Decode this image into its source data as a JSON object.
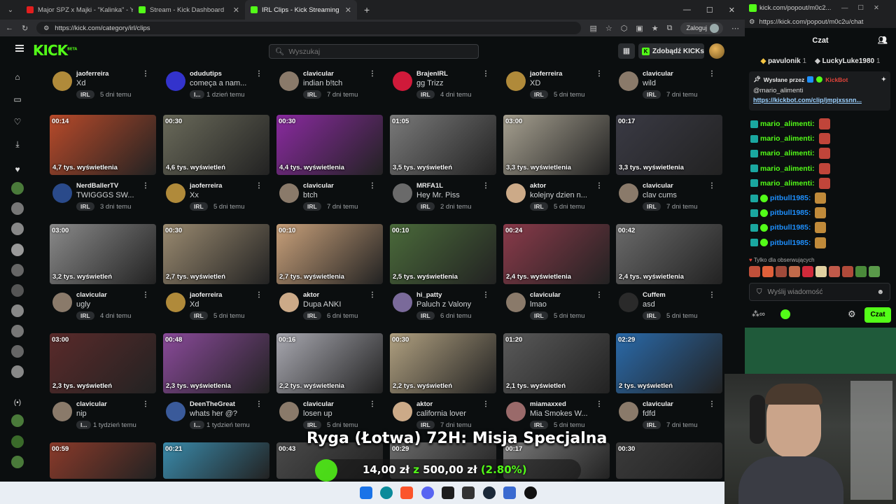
{
  "browser": {
    "tabs": [
      {
        "label": "Major SPZ x Majki - \"Kalinka\" - Yo",
        "color": "#e21e1e"
      },
      {
        "label": "Stream - Kick Dashboard",
        "color": "#53fc18"
      },
      {
        "label": "IRL Clips - Kick Streaming",
        "color": "#53fc18"
      }
    ],
    "url": "https://kick.com/category/irl/clips",
    "login_label": "Zaloguj"
  },
  "kick": {
    "search_placeholder": "Wyszukaj",
    "kicks_button": "Zdobądź KICKs",
    "logo": "KICK",
    "logo_sup": "BETA"
  },
  "clips": [
    {
      "row": 0,
      "user": "jaoferreira",
      "title": "Xd",
      "tag": "IRL",
      "age": "5 dni temu",
      "avatar_color": "#b08a3a"
    },
    {
      "row": 0,
      "user": "odudutips",
      "title": "começa a nam...",
      "tag": "I...",
      "age": "1 dzień temu",
      "avatar_color": "#3333cc"
    },
    {
      "row": 0,
      "user": "clavicular",
      "title": "indian b!tch",
      "tag": "IRL",
      "age": "7 dni temu",
      "avatar_color": "#8a7a6a"
    },
    {
      "row": 0,
      "user": "BrajenIRL",
      "title": "gg Trizz",
      "tag": "IRL",
      "age": "4 dni temu",
      "avatar_color": "#d01a3a"
    },
    {
      "row": 0,
      "user": "jaoferreira",
      "title": "XD",
      "tag": "IRL",
      "age": "5 dni temu",
      "avatar_color": "#b08a3a"
    },
    {
      "row": 0,
      "user": "clavicular",
      "title": "wild",
      "tag": "IRL",
      "age": "7 dni temu",
      "avatar_color": "#8a7a6a"
    },
    {
      "row": 1,
      "duration": "00:14",
      "views": "4,7 tys. wyświetlenia",
      "user": "NerdBallerTV",
      "title": "TWIGGGS SW...",
      "tag": "IRL",
      "age": "3 dni temu",
      "avatar_color": "#2a4a8a",
      "thumb": "#b84a2a"
    },
    {
      "row": 1,
      "duration": "00:30",
      "views": "4,6 tys. wyświetleń",
      "user": "jaoferreira",
      "title": "Xx",
      "tag": "IRL",
      "age": "5 dni temu",
      "avatar_color": "#b08a3a",
      "thumb": "#6a6a5a"
    },
    {
      "row": 1,
      "duration": "00:30",
      "views": "4,4 tys. wyświetlenia",
      "user": "clavicular",
      "title": "btch",
      "tag": "IRL",
      "age": "7 dni temu",
      "avatar_color": "#8a7a6a",
      "thumb": "#8a2aa0"
    },
    {
      "row": 1,
      "duration": "01:05",
      "views": "3,5 tys. wyświetleń",
      "user": "MRFA1L",
      "title": "Hey Mr. Piss",
      "tag": "IRL",
      "age": "2 dni temu",
      "avatar_color": "#6a6a6a",
      "thumb": "#7a7a7a"
    },
    {
      "row": 1,
      "duration": "03:00",
      "views": "3,3 tys. wyświetlenia",
      "user": "aktor",
      "title": "kolejny dzien n...",
      "tag": "IRL",
      "age": "5 dni temu",
      "avatar_color": "#ccaa88",
      "thumb": "#a6a090"
    },
    {
      "row": 1,
      "duration": "00:17",
      "views": "3,3 tys. wyświetlenia",
      "user": "clavicular",
      "title": "clav cums",
      "tag": "IRL",
      "age": "7 dni temu",
      "avatar_color": "#8a7a6a",
      "thumb": "#3a3a44"
    },
    {
      "row": 2,
      "duration": "03:00",
      "views": "3,2 tys. wyświetleń",
      "user": "clavicular",
      "title": "ugly",
      "tag": "IRL",
      "age": "4 dni temu",
      "avatar_color": "#8a7a6a",
      "thumb": "#8a8a8a"
    },
    {
      "row": 2,
      "duration": "00:30",
      "views": "2,7 tys. wyświetleń",
      "user": "jaoferreira",
      "title": "Xd",
      "tag": "IRL",
      "age": "5 dni temu",
      "avatar_color": "#b08a3a",
      "thumb": "#9a8a70"
    },
    {
      "row": 2,
      "duration": "00:10",
      "views": "2,7 tys. wyświetlenia",
      "user": "aktor",
      "title": "Dupa ANKI",
      "tag": "IRL",
      "age": "6 dni temu",
      "avatar_color": "#ccaa88",
      "thumb": "#c8a07a"
    },
    {
      "row": 2,
      "duration": "00:10",
      "views": "2,5 tys. wyświetlenia",
      "user": "hi_patty",
      "title": "Paluch z Valony",
      "tag": "IRL",
      "age": "6 dni temu",
      "avatar_color": "#7a6a9a",
      "thumb": "#4a6a3a"
    },
    {
      "row": 2,
      "duration": "00:24",
      "views": "2,4 tys. wyświetlenia",
      "user": "clavicular",
      "title": "lmao",
      "tag": "IRL",
      "age": "5 dni temu",
      "avatar_color": "#8a7a6a",
      "thumb": "#8a3a4a"
    },
    {
      "row": 2,
      "duration": "00:42",
      "views": "2,4 tys. wyświetlenia",
      "user": "Cuffem",
      "title": "asd",
      "tag": "IRL",
      "age": "5 dni temu",
      "avatar_color": "#2a2a2a",
      "thumb": "#6a6a6a"
    },
    {
      "row": 3,
      "duration": "03:00",
      "views": "2,3 tys. wyświetleń",
      "user": "clavicular",
      "title": "nip",
      "tag": "I...",
      "age": "1 tydzień temu",
      "avatar_color": "#8a7a6a",
      "thumb": "#5a2a2a"
    },
    {
      "row": 3,
      "duration": "00:48",
      "views": "2,3 tys. wyświetlenia",
      "user": "DeenTheGreat",
      "title": "whats her @?",
      "tag": "I...",
      "age": "1 tydzień temu",
      "avatar_color": "#3a5a9a",
      "thumb": "#8a4a9a"
    },
    {
      "row": 3,
      "duration": "00:16",
      "views": "2,2 tys. wyświetlenia",
      "user": "clavicular",
      "title": "losen up",
      "tag": "IRL",
      "age": "5 dni temu",
      "avatar_color": "#8a7a6a",
      "thumb": "#a8a8b0"
    },
    {
      "row": 3,
      "duration": "00:30",
      "views": "2,2 tys. wyświetleń",
      "user": "aktor",
      "title": "california lover",
      "tag": "IRL",
      "age": "7 dni temu",
      "avatar_color": "#ccaa88",
      "thumb": "#b0a080"
    },
    {
      "row": 3,
      "duration": "01:20",
      "views": "2,1 tys. wyświetleń",
      "user": "miamaxxed",
      "title": "Mia Smokes W...",
      "tag": "IRL",
      "age": "5 dni temu",
      "avatar_color": "#9a6a6a",
      "thumb": "#5a5a5a"
    },
    {
      "row": 3,
      "duration": "02:29",
      "views": "2 tys. wyświetleń",
      "user": "clavicular",
      "title": "fdfd",
      "tag": "IRL",
      "age": "7 dni temu",
      "avatar_color": "#8a7a6a",
      "thumb": "#2a6aaa"
    },
    {
      "row": 4,
      "duration": "00:59",
      "thumb": "#8a3a2a"
    },
    {
      "row": 4,
      "duration": "00:21",
      "thumb": "#3a8aaa"
    },
    {
      "row": 4,
      "duration": "00:43",
      "thumb": "#4a4a4a"
    },
    {
      "row": 4,
      "duration": "00:29",
      "thumb": "#6a6a6a"
    },
    {
      "row": 4,
      "duration": "00:17",
      "thumb": "#7a7a7a"
    },
    {
      "row": 4,
      "duration": "00:30",
      "thumb": "#3a3a3a"
    }
  ],
  "chat": {
    "popout_url": "kick.com/popout/m0c2...",
    "url": "https://kick.com/popout/m0c2u/chat",
    "header": "Czat",
    "top_gifters": [
      {
        "name": "pavulonik",
        "count": "1"
      },
      {
        "name": "LuckyLuke1980",
        "count": "1"
      }
    ],
    "pinned_by_label": "Wysłane przez",
    "pinned_by": "KickBot",
    "pinned_user": "@mario_alimenti",
    "pinned_link": "https://kickbot.com/clip/jmpjxssnn...",
    "messages": [
      {
        "user": "mario_alimenti:",
        "color": "#53fc18"
      },
      {
        "user": "mario_alimenti:",
        "color": "#53fc18"
      },
      {
        "user": "mario_alimenti:",
        "color": "#53fc18"
      },
      {
        "user": "mario_alimenti:",
        "color": "#53fc18"
      },
      {
        "user": "mario_alimenti:",
        "color": "#53fc18"
      },
      {
        "user": "pitbull1985:",
        "color": "#1e90ff"
      },
      {
        "user": "pitbull1985:",
        "color": "#1e90ff"
      },
      {
        "user": "pitbull1985:",
        "color": "#1e90ff"
      },
      {
        "user": "pitbull1985:",
        "color": "#1e90ff"
      }
    ],
    "followers_only": "Tylko dla obserwujących",
    "input_placeholder": "Wyślij wiadomość",
    "send_label": "Czat"
  },
  "overlay": {
    "title": "Ryga (Łotwa) 72H: Misja Specjalna",
    "amount": "14,00 zł",
    "sep": "z",
    "goal": "500,00 zł",
    "percent": "(2.80%)",
    "progress": 0.028
  },
  "colors": {
    "accent": "#53fc18",
    "bg": "#0b0e0f"
  }
}
